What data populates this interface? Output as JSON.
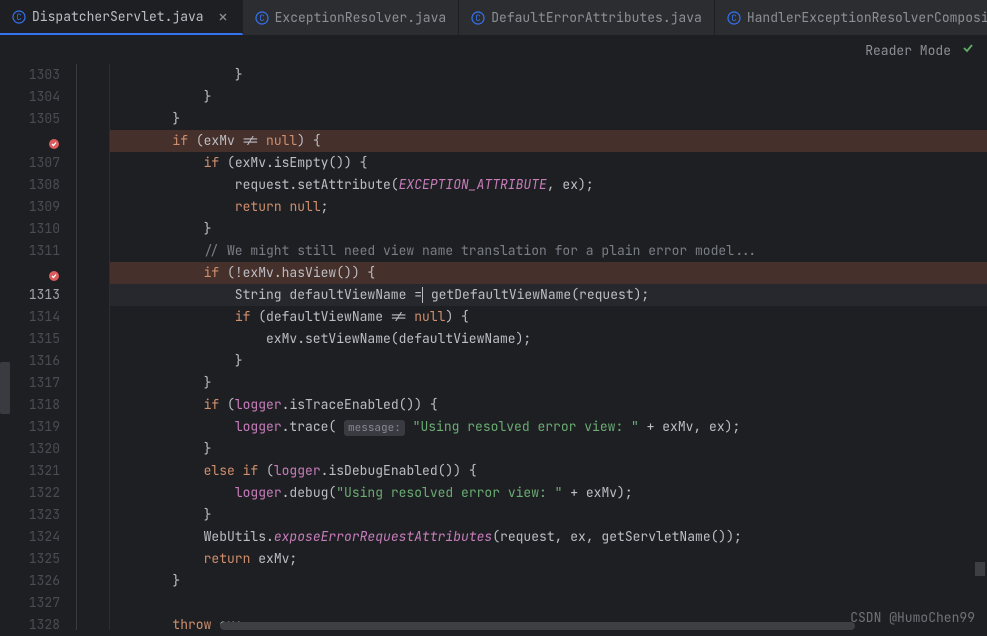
{
  "tabs": [
    {
      "label": "DispatcherServlet.java",
      "active": true
    },
    {
      "label": "ExceptionResolver.java",
      "active": false
    },
    {
      "label": "DefaultErrorAttributes.java",
      "active": false
    },
    {
      "label": "HandlerExceptionResolverComposi",
      "active": false
    }
  ],
  "reader_mode": "Reader Mode",
  "lines": {
    "start": 1303,
    "end": 1328,
    "current": 1313,
    "breakpoints": [
      1306,
      1312
    ]
  },
  "code_tokens": {
    "exception_attr": "EXCEPTION_ATTRIBUTE",
    "comment_1311": "// We might still need view name translation for a plain error model...",
    "param_hint": "message:",
    "str_trace": "\"Using resolved error view: \"",
    "str_debug": "\"Using resolved error view: \"",
    "static_call": "exposeErrorRequestAttributes"
  },
  "watermark": "CSDN @HumoChen99"
}
